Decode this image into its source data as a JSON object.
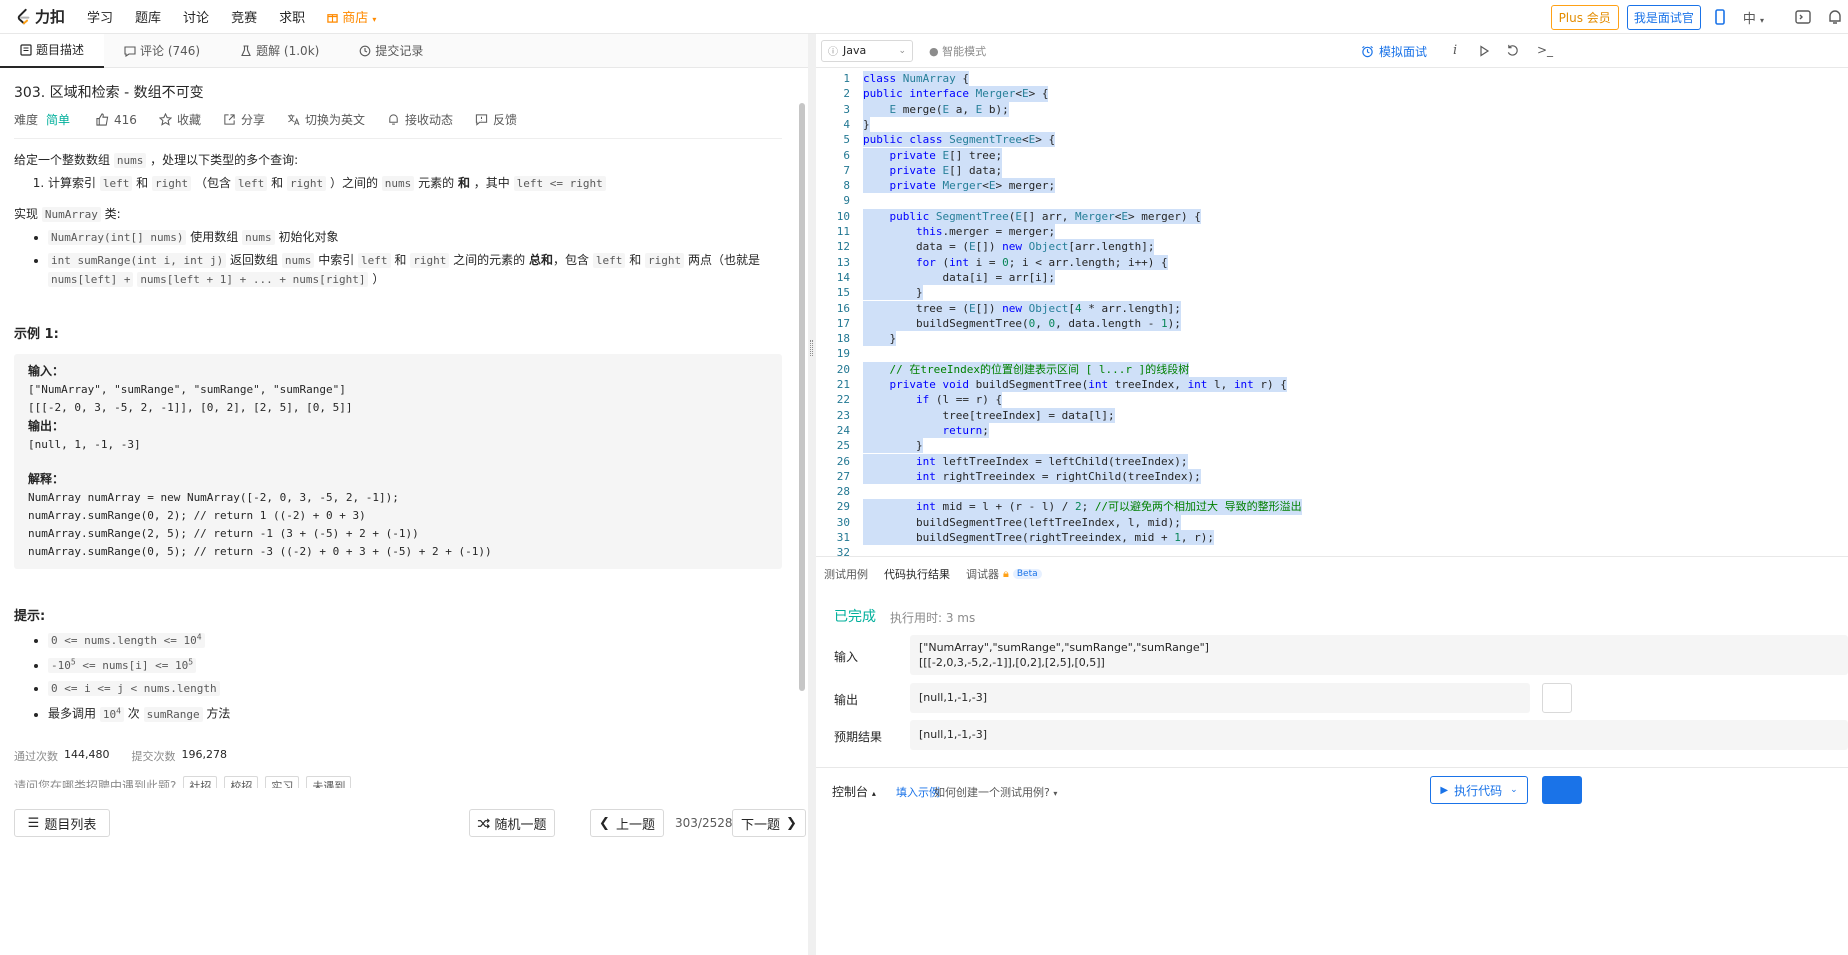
{
  "topbar": {
    "logo_text": "力扣",
    "nav": [
      "学习",
      "题库",
      "讨论",
      "竞赛",
      "求职"
    ],
    "shop": "商店",
    "plus": "Plus 会员",
    "interviewer": "我是面试官",
    "lang": "中"
  },
  "left_tabs": [
    {
      "label": "题目描述"
    },
    {
      "label": "评论 (746)"
    },
    {
      "label": "题解 (1.0k)"
    },
    {
      "label": "提交记录"
    }
  ],
  "problem": {
    "title": "303. 区域和检索 - 数组不可变",
    "difficulty_label": "难度",
    "difficulty": "简单",
    "likes": "416",
    "favorite": "收藏",
    "share": "分享",
    "switch_en": "切换为英文",
    "subscribe": "接收动态",
    "feedback": "反馈",
    "intro_1": "给定一个整数数组",
    "intro_code": "nums",
    "intro_2": "，处理以下类型的多个查询:",
    "q1_a": "计算索引",
    "q1_left": "left",
    "q1_and": "和",
    "q1_right": "right",
    "q1_b": "（包含",
    "q1_c": "）之间的",
    "q1_nums": "nums",
    "q1_d": "元素的",
    "q1_sum": "和",
    "q1_e": "，其中",
    "q1_cond": "left <= right",
    "impl_a": "实现",
    "impl_code": "NumArray",
    "impl_b": "类:",
    "b1_code": "NumArray(int[] nums)",
    "b1_text": "使用数组",
    "b1_nums": "nums",
    "b1_tail": "初始化对象",
    "b2_code": "int sumRange(int i, int j)",
    "b2_text": "返回数组",
    "b2_nums": "nums",
    "b2_mid": "中索引",
    "b2_between": "之间的元素的",
    "b2_total": "总和",
    "b2_incl": "，包含",
    "b2_points": "两点（也就是",
    "b2_formula1": "nums[left] +",
    "b2_formula2": "nums[left + 1] + ... + nums[right]",
    "b2_close": "）",
    "example_title": "示例 1:",
    "ex_input_label": "输入：",
    "ex_input_1": "[\"NumArray\", \"sumRange\", \"sumRange\", \"sumRange\"]",
    "ex_input_2": "[[[-2, 0, 3, -5, 2, -1]], [0, 2], [2, 5], [0, 5]]",
    "ex_output_label": "输出：",
    "ex_output": "[null, 1, -1, -3]",
    "ex_explain_label": "解释：",
    "ex_explain": [
      "NumArray numArray = new NumArray([-2, 0, 3, -5, 2, -1]);",
      "numArray.sumRange(0, 2); // return 1 ((-2) + 0 + 3)",
      "numArray.sumRange(2, 5); // return -1 (3 + (-5) + 2 + (-1))",
      "numArray.sumRange(0, 5); // return -3 ((-2) + 0 + 3 + (-5) + 2 + (-1))"
    ],
    "hints_title": "提示:",
    "h1": "0 <= nums.length <= 10",
    "h1_sup": "4",
    "h2_a": "-10",
    "h2_sup": "5",
    "h2_b": " <= nums[i] <= 10",
    "h2_sup2": "5",
    "h3": "0 <= i <= j < nums.length",
    "h4_a": "最多调用",
    "h4_num": "10",
    "h4_sup": "4",
    "h4_b": "次",
    "h4_code": "sumRange",
    "h4_c": "方法",
    "passed_label": "通过次数",
    "passed": "144,480",
    "submitted_label": "提交次数",
    "submitted": "196,278",
    "survey": "请问您在哪类招聘中遇到此题?",
    "chips": [
      "社招",
      "校招",
      "实习",
      "未遇到"
    ]
  },
  "bottom_left": {
    "list": "题目列表",
    "random": "随机一题",
    "prev": "上一题",
    "page": "303/2528",
    "next": "下一题"
  },
  "editor_tool": {
    "language": "Java",
    "smart_mode": "智能模式",
    "mock": "模拟面试"
  },
  "code_lines": [
    {
      "n": "1",
      "t": "class NumArray {"
    },
    {
      "n": "2",
      "t": "public interface Merger<E> {"
    },
    {
      "n": "3",
      "t": "    E merge(E a, E b);"
    },
    {
      "n": "4",
      "t": "}"
    },
    {
      "n": "5",
      "t": "public class SegmentTree<E> {"
    },
    {
      "n": "6",
      "t": "    private E[] tree;"
    },
    {
      "n": "7",
      "t": "    private E[] data;"
    },
    {
      "n": "8",
      "t": "    private Merger<E> merger;"
    },
    {
      "n": "9",
      "t": ""
    },
    {
      "n": "10",
      "t": "    public SegmentTree(E[] arr, Merger<E> merger) {"
    },
    {
      "n": "11",
      "t": "        this.merger = merger;"
    },
    {
      "n": "12",
      "t": "        data = (E[]) new Object[arr.length];"
    },
    {
      "n": "13",
      "t": "        for (int i = 0; i < arr.length; i++) {"
    },
    {
      "n": "14",
      "t": "            data[i] = arr[i];"
    },
    {
      "n": "15",
      "t": "        }"
    },
    {
      "n": "16",
      "t": "        tree = (E[]) new Object[4 * arr.length];"
    },
    {
      "n": "17",
      "t": "        buildSegmentTree(0, 0, data.length - 1);"
    },
    {
      "n": "18",
      "t": "    }"
    },
    {
      "n": "19",
      "t": ""
    },
    {
      "n": "20",
      "t": "    // 在treeIndex的位置创建表示区间 [ l...r ]的线段树"
    },
    {
      "n": "21",
      "t": "    private void buildSegmentTree(int treeIndex, int l, int r) {"
    },
    {
      "n": "22",
      "t": "        if (l == r) {"
    },
    {
      "n": "23",
      "t": "            tree[treeIndex] = data[l];"
    },
    {
      "n": "24",
      "t": "            return;"
    },
    {
      "n": "25",
      "t": "        }"
    },
    {
      "n": "26",
      "t": "        int leftTreeIndex = leftChild(treeIndex);"
    },
    {
      "n": "27",
      "t": "        int rightTreeindex = rightChild(treeIndex);"
    },
    {
      "n": "28",
      "t": ""
    },
    {
      "n": "29",
      "t": "        int mid = l + (r - l) / 2; //可以避免两个相加过大 导致的整形溢出"
    },
    {
      "n": "30",
      "t": "        buildSegmentTree(leftTreeIndex, l, mid);"
    },
    {
      "n": "31",
      "t": "        buildSegmentTree(rightTreeindex, mid + 1, r);"
    },
    {
      "n": "32",
      "t": ""
    }
  ],
  "panel_tabs": {
    "testcase": "测试用例",
    "result": "代码执行结果",
    "debugger": "调试器",
    "beta": "Beta"
  },
  "result": {
    "status": "已完成",
    "exec_time": "执行用时: 3 ms",
    "input_label": "输入",
    "input_1": "[\"NumArray\",\"sumRange\",\"sumRange\",\"sumRange\"]",
    "input_2": "[[[-2,0,3,-5,2,-1]],[0,2],[2,5],[0,5]]",
    "output_label": "输出",
    "output": "[null,1,-1,-3]",
    "expected_label": "预期结果",
    "expected": "[null,1,-1,-3]"
  },
  "console_bar": {
    "console": "控制台",
    "fill_example": "填入示例",
    "how_to": "如何创建一个测试用例?",
    "run": "执行代码"
  }
}
